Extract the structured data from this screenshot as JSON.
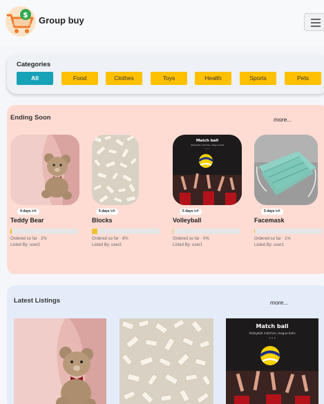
{
  "app": {
    "title": "Group buy",
    "logo_icon": "shopping-cart-dollar-icon",
    "menu_icon": "hamburger-menu-icon"
  },
  "categories": {
    "title": "Categories",
    "items": [
      {
        "label": "All",
        "active": true
      },
      {
        "label": "Food",
        "active": false
      },
      {
        "label": "Clothes",
        "active": false
      },
      {
        "label": "Toys",
        "active": false
      },
      {
        "label": "Health",
        "active": false
      },
      {
        "label": "Sports",
        "active": false
      },
      {
        "label": "Pets",
        "active": false
      }
    ]
  },
  "ending_soon": {
    "title": "Ending Soon",
    "more_label": "more...",
    "items": [
      {
        "name": "Teddy Bear",
        "days": "4 days",
        "days_suffix": "left",
        "ordered": "Ordered so far · 2%",
        "progress_pct": 2,
        "listed_by": "Listed By: user2",
        "image": "teddy-bear-photo"
      },
      {
        "name": "Blocks",
        "days": "5 days",
        "days_suffix": "left",
        "ordered": "Ordered so far · 8%",
        "progress_pct": 8,
        "listed_by": "Listed By: user2",
        "image": "white-blocks-photo"
      },
      {
        "name": "Volleyball",
        "days": "5 days",
        "days_suffix": "left",
        "ordered": "Ordered so far · 0%",
        "progress_pct": 0,
        "listed_by": "Listed By: user1",
        "image": "volleyball-match-poster"
      },
      {
        "name": "Facemask",
        "days": "5 days",
        "days_suffix": "left",
        "ordered": "Ordered so far · 1%",
        "progress_pct": 1,
        "listed_by": "Listed By: user1",
        "image": "facemask-photo"
      }
    ]
  },
  "latest_listings": {
    "title": "Latest Listings",
    "more_label": "more...",
    "items": [
      {
        "image": "teddy-bear-photo"
      },
      {
        "image": "white-blocks-photo"
      },
      {
        "image": "volleyball-match-poster"
      }
    ]
  },
  "poster": {
    "title": "Match ball",
    "subtitle": "Volleyball matches, league balls",
    "dots": "• • •"
  },
  "colors": {
    "accent": "#17a2b8",
    "chip": "#ffc000",
    "ending_bg": "#fedcd4",
    "latest_bg": "#e4ecfa",
    "progress": "#f2c12e"
  }
}
